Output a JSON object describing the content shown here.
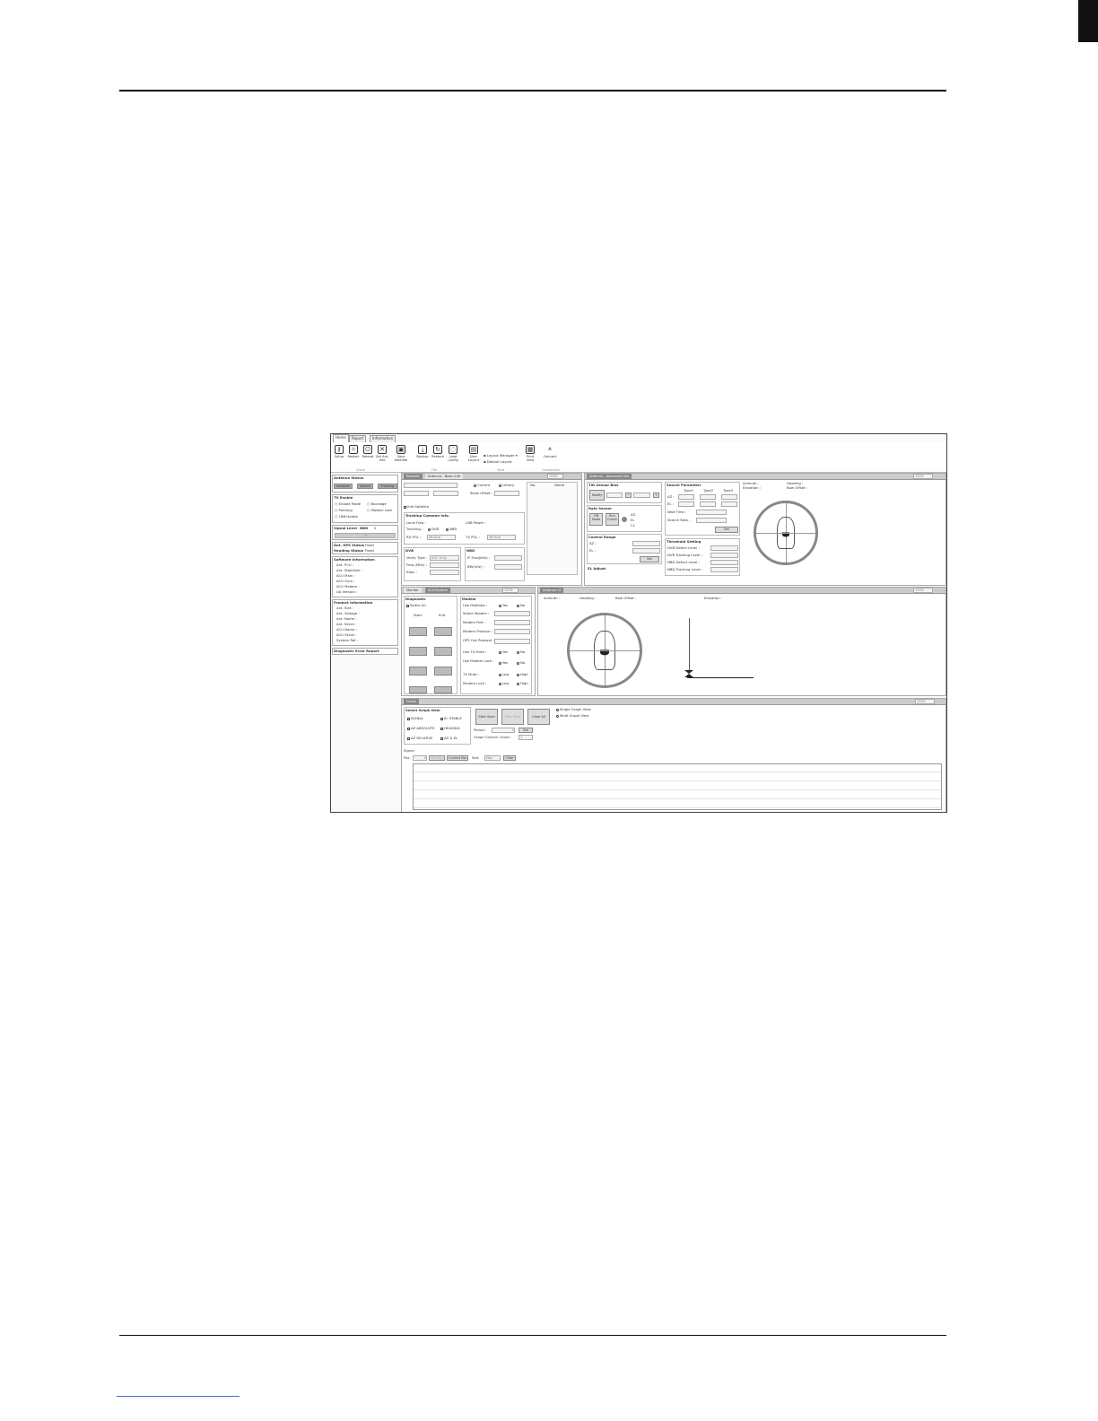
{
  "ribbon": {
    "tabs": [
      "Home",
      "Report",
      "Information"
    ],
    "buttons": [
      {
        "label": "Setup"
      },
      {
        "label": "Restart"
      },
      {
        "label": "Reboot"
      },
      {
        "label": "Get Ant. Info"
      },
      {
        "label": "Save Satellite"
      },
      {
        "label": "Backup"
      },
      {
        "label": "Restore"
      },
      {
        "label": "Load Config"
      },
      {
        "label": "User Layout"
      },
      {
        "label": "Layout Manager"
      },
      {
        "label": "Default Layout"
      },
      {
        "label": "Print View"
      },
      {
        "label": "Connect"
      }
    ],
    "groups": [
      "Quick",
      "File",
      "View",
      "Connection"
    ]
  },
  "sidebar": {
    "antenna_status": {
      "title": "Antenna Status",
      "states": [
        "Initialize",
        "Search",
        "Tracking"
      ]
    },
    "tx_enable": {
      "title": "TX Enable",
      "items": [
        "Enable Mode",
        "Blockage",
        "Pointing",
        "Modem Lock",
        "LNB Isolate"
      ]
    },
    "signal": {
      "title": "Signal Level",
      "mode": "NBD",
      "value": "0"
    },
    "gps": {
      "gps_label": "Ant. GPS Status",
      "gps_value": "Fixed",
      "heading_label": "Heading Status",
      "heading_value": "Fixed"
    },
    "software": {
      "title": "Software Information",
      "items": [
        "Ant. PCU :",
        "Ant. Stabilizer :",
        "ACU Main :",
        "ACU Gyro :",
        "ACU Modem :",
        "Lib Version :"
      ]
    },
    "product": {
      "title": "Product Information",
      "items": [
        "Ant. Size :",
        "Ant. Voltage :",
        "Ant. Name :",
        "Ant. Serial :",
        "ACU Name :",
        "ACU Serial :",
        "System Ref :"
      ]
    },
    "diag_report": "Diagnostic Error Report"
  },
  "satellite_panel": {
    "tabs": [
      "Satellite",
      "Antenna - Basic Info"
    ],
    "zoom": "100%",
    "current": "Current",
    "library": "Library",
    "skew_offset": "Skew Offset :",
    "edit_satellite": "Edit Satellite",
    "list_headers": [
      "No.",
      "Name"
    ],
    "tracking_common": "Tracking Common Info.",
    "local_freq": "Local Freq :",
    "lnb_power": "LNB Power :",
    "tracking": "Tracking :",
    "dvb": "DVB",
    "nbd": "NBD",
    "rx_pol": "RX POL :",
    "tx_pol": "TX POL :",
    "vertical": "Vertical",
    "dvb_title": "DVB",
    "verify_type": "Verify Type :",
    "agc_only": "AGC Only",
    "freq": "Freq (MHz) :",
    "ksps": "KSps :",
    "nbd_title": "NBD",
    "if_freq": "IF Freq(kHz) :",
    "bw": "BW(kHz) :"
  },
  "advanced_panel": {
    "tab": "Antenna - Advanced Info",
    "zoom": "100%",
    "tilt_title": "Tilt Sensor Bias",
    "modify": "Modify",
    "rate_title": "Rate Sensor",
    "on_mode": "ON Mode",
    "run_check": "Run Check",
    "rate_axes": [
      "AZ",
      "EL",
      "CL"
    ],
    "control_range": "Control Range",
    "az": "AZ :",
    "el": "EL :",
    "set": "Set",
    "el_adjust": "EL Adjust",
    "search_param": "Search Parameter",
    "types": [
      "Type1",
      "Type2",
      "Type3"
    ],
    "wait_time": "Wait Time :",
    "search_step": "Search Step :",
    "threshold": "Threshold Setting",
    "thresholds": [
      "DVB Detect Level :",
      "DVB Tracking Level :",
      "NBD Detect Level :",
      "NBD Tracking Level :"
    ],
    "azimuth": "Azimuth :",
    "heading": "Heading :",
    "elevation": "Elevation :",
    "bow_offset": "Bow Offset :"
  },
  "monitor_panel": {
    "tabs": [
      "Monitor",
      "ACU/System"
    ],
    "zoom": "100%",
    "diag_title": "Diagnostic",
    "select_all": "Select All",
    "start": "Start",
    "end": "End",
    "modem_title": "Modem",
    "use_mediator": "Use Mediator :",
    "yes": "Yes",
    "no": "No",
    "select_modem": "Select Modem :",
    "modem_port": "Modem Port :",
    "modem_protocol": "Modem Protocol :",
    "gps_out": "GPS Out Protocol :",
    "use_tx_mute": "Use TX Mute :",
    "use_modem_lock": "Use Modem Lock :",
    "tx_mute": "TX Mute :",
    "modem_lock": "Modem Lock :",
    "low": "Low",
    "high": "High"
  },
  "antenna_ui_panel": {
    "tab": "Antenna UI",
    "zoom": "100%",
    "azimuth": "Azimuth :",
    "heading": "Heading :",
    "bow_offset": "Bow Offset :",
    "elevation": "Elevation :"
  },
  "graph_panel": {
    "tab": "Graph",
    "zoom": "100%",
    "select_title": "Select Graph Item",
    "items": [
      "SIGNAL",
      "EL STABLE",
      "AZ ABSOLUTE",
      "HEADING",
      "AZ RELATIVE",
      "AZ & EL"
    ],
    "start_save": "Start Save",
    "stop_save": "Stop Save",
    "clear_all": "Clear All",
    "single": "Single Graph View",
    "multi": "Multi Graph View",
    "period": "Period :",
    "period_value": "1",
    "set": "Set",
    "column_count": "Graph Column Count :",
    "column_value": "1",
    "signal": "Signal",
    "pos": "Pos",
    "pos_value": "0",
    "set_pos": "Set Pos",
    "current_pos": "Current Pos",
    "sort": "Sort",
    "sort_value": "Max",
    "clear": "Clear"
  }
}
